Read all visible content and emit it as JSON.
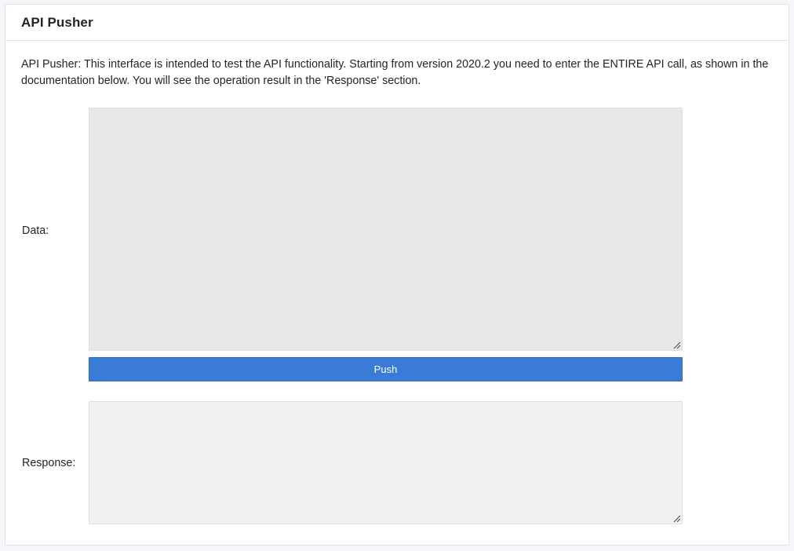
{
  "card": {
    "title": "API Pusher"
  },
  "intro": {
    "text": "API Pusher: This interface is intended to test the API functionality. Starting from version 2020.2 you need to enter the ENTIRE API call, as shown in the documentation below. You will see the operation result in the 'Response' section."
  },
  "form": {
    "data_label": "Data:",
    "data_value": "",
    "push_label": "Push",
    "response_label": "Response:",
    "response_value": ""
  },
  "colors": {
    "accent": "#3a7bd5",
    "data_bg": "#e8e8e8",
    "response_bg": "#f1f1f1"
  }
}
